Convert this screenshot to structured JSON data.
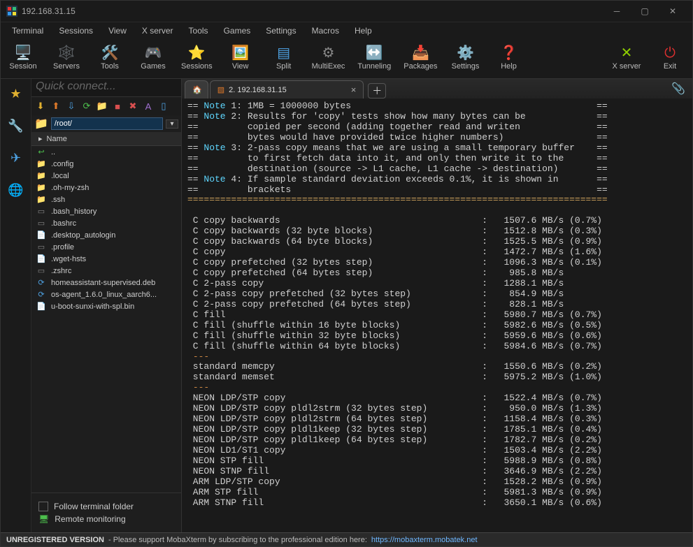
{
  "title": "192.168.31.15",
  "menubar": [
    "Terminal",
    "Sessions",
    "View",
    "X server",
    "Tools",
    "Games",
    "Settings",
    "Macros",
    "Help"
  ],
  "toolbar": [
    {
      "label": "Session",
      "glyph": "🖥️"
    },
    {
      "label": "Servers",
      "glyph": "🕸️",
      "cls": "clime"
    },
    {
      "label": "Tools",
      "glyph": "🛠️",
      "cls": "co"
    },
    {
      "label": "Games",
      "glyph": "🎮"
    },
    {
      "label": "Sessions",
      "glyph": "⭐",
      "cls": "cy"
    },
    {
      "label": "View",
      "glyph": "🖼️"
    },
    {
      "label": "Split",
      "glyph": "▤",
      "cls": "cb"
    },
    {
      "label": "MultiExec",
      "glyph": "⚙",
      "cls": "cgray"
    },
    {
      "label": "Tunneling",
      "glyph": "↔️",
      "cls": "cg"
    },
    {
      "label": "Packages",
      "glyph": "📥",
      "cls": "cb"
    },
    {
      "label": "Settings",
      "glyph": "⚙️",
      "cls": "cy"
    },
    {
      "label": "Help",
      "glyph": "❓",
      "cls": "cb"
    }
  ],
  "toolbar_right": [
    {
      "label": "X server",
      "glyph": "✕",
      "cls": "clime"
    },
    {
      "label": "Exit",
      "glyph": "⏻",
      "cls": "cred"
    }
  ],
  "quick_connect": "Quick connect...",
  "path": "/root/",
  "file_header": "Name",
  "files": [
    {
      "name": "..",
      "icon": "↩",
      "cls": "cg"
    },
    {
      "name": ".config",
      "icon": "📁",
      "cls": "cy"
    },
    {
      "name": ".local",
      "icon": "📁",
      "cls": "cy"
    },
    {
      "name": ".oh-my-zsh",
      "icon": "📁",
      "cls": "cy"
    },
    {
      "name": ".ssh",
      "icon": "📁",
      "cls": "cy"
    },
    {
      "name": ".bash_history",
      "icon": "▭",
      "cls": "cgray"
    },
    {
      "name": ".bashrc",
      "icon": "▭",
      "cls": "cgray"
    },
    {
      "name": ".desktop_autologin",
      "icon": "📄",
      "cls": "cgray"
    },
    {
      "name": ".profile",
      "icon": "▭",
      "cls": "cgray"
    },
    {
      "name": ".wget-hsts",
      "icon": "📄",
      "cls": "cgray"
    },
    {
      "name": ".zshrc",
      "icon": "▭",
      "cls": "cgray"
    },
    {
      "name": "homeassistant-supervised.deb",
      "icon": "⟳",
      "cls": "cb"
    },
    {
      "name": "os-agent_1.6.0_linux_aarch6...",
      "icon": "⟳",
      "cls": "cb"
    },
    {
      "name": "u-boot-sunxi-with-spl.bin",
      "icon": "📄",
      "cls": "cgray"
    }
  ],
  "follow_label": "Follow terminal folder",
  "remote_label": "Remote monitoring",
  "tabs": {
    "active": "2. 192.168.31.15"
  },
  "notes": [
    {
      "n": "1",
      "text": "1MB = 1000000 bytes"
    },
    {
      "n": "2",
      "text": "Results for 'copy' tests show how many bytes can be"
    },
    {
      "cont": "copied per second (adding together read and writen"
    },
    {
      "cont": "bytes would have provided twice higher numbers)"
    },
    {
      "n": "3",
      "text": "2-pass copy means that we are using a small temporary buffer"
    },
    {
      "cont": "to first fetch data into it, and only then write it to the"
    },
    {
      "cont": "destination (source -> L1 cache, L1 cache -> destination)"
    },
    {
      "n": "4",
      "text": "If sample standard deviation exceeds 0.1%, it is shown in"
    },
    {
      "cont": "brackets"
    }
  ],
  "bench": [
    {
      "label": "C copy backwards",
      "val": "1507.6 MB/s",
      "dev": "(0.7%)"
    },
    {
      "label": "C copy backwards (32 byte blocks)",
      "val": "1512.8 MB/s",
      "dev": "(0.3%)"
    },
    {
      "label": "C copy backwards (64 byte blocks)",
      "val": "1525.5 MB/s",
      "dev": "(0.9%)"
    },
    {
      "label": "C copy",
      "val": "1472.7 MB/s",
      "dev": "(1.6%)"
    },
    {
      "label": "C copy prefetched (32 bytes step)",
      "val": "1096.3 MB/s",
      "dev": "(0.1%)"
    },
    {
      "label": "C copy prefetched (64 bytes step)",
      "val": "985.8 MB/s",
      "dev": ""
    },
    {
      "label": "C 2-pass copy",
      "val": "1288.1 MB/s",
      "dev": ""
    },
    {
      "label": "C 2-pass copy prefetched (32 bytes step)",
      "val": "854.9 MB/s",
      "dev": ""
    },
    {
      "label": "C 2-pass copy prefetched (64 bytes step)",
      "val": "828.1 MB/s",
      "dev": ""
    },
    {
      "label": "C fill",
      "val": "5980.7 MB/s",
      "dev": "(0.7%)"
    },
    {
      "label": "C fill (shuffle within 16 byte blocks)",
      "val": "5982.6 MB/s",
      "dev": "(0.5%)"
    },
    {
      "label": "C fill (shuffle within 32 byte blocks)",
      "val": "5959.6 MB/s",
      "dev": "(0.6%)"
    },
    {
      "label": "C fill (shuffle within 64 byte blocks)",
      "val": "5984.6 MB/s",
      "dev": "(0.7%)"
    }
  ],
  "bench2": [
    {
      "label": "standard memcpy",
      "val": "1550.6 MB/s",
      "dev": "(0.2%)"
    },
    {
      "label": "standard memset",
      "val": "5975.2 MB/s",
      "dev": "(1.0%)"
    }
  ],
  "bench3": [
    {
      "label": "NEON LDP/STP copy",
      "val": "1522.4 MB/s",
      "dev": "(0.7%)"
    },
    {
      "label": "NEON LDP/STP copy pldl2strm (32 bytes step)",
      "val": "950.0 MB/s",
      "dev": "(1.3%)"
    },
    {
      "label": "NEON LDP/STP copy pldl2strm (64 bytes step)",
      "val": "1158.4 MB/s",
      "dev": "(0.3%)"
    },
    {
      "label": "NEON LDP/STP copy pldl1keep (32 bytes step)",
      "val": "1785.1 MB/s",
      "dev": "(0.4%)"
    },
    {
      "label": "NEON LDP/STP copy pldl1keep (64 bytes step)",
      "val": "1782.7 MB/s",
      "dev": "(0.2%)"
    },
    {
      "label": "NEON LD1/ST1 copy",
      "val": "1503.4 MB/s",
      "dev": "(2.2%)"
    },
    {
      "label": "NEON STP fill",
      "val": "5988.9 MB/s",
      "dev": "(0.8%)"
    },
    {
      "label": "NEON STNP fill",
      "val": "3646.9 MB/s",
      "dev": "(2.2%)"
    },
    {
      "label": "ARM LDP/STP copy",
      "val": "1528.2 MB/s",
      "dev": "(0.9%)"
    },
    {
      "label": "ARM STP fill",
      "val": "5981.3 MB/s",
      "dev": "(0.9%)"
    },
    {
      "label": "ARM STNP fill",
      "val": "3650.1 MB/s",
      "dev": "(0.6%)"
    }
  ],
  "status": {
    "left": "UNREGISTERED VERSION",
    "mid": "-  Please support MobaXterm by subscribing to the professional edition here:",
    "url": "https://mobaxterm.mobatek.net"
  }
}
